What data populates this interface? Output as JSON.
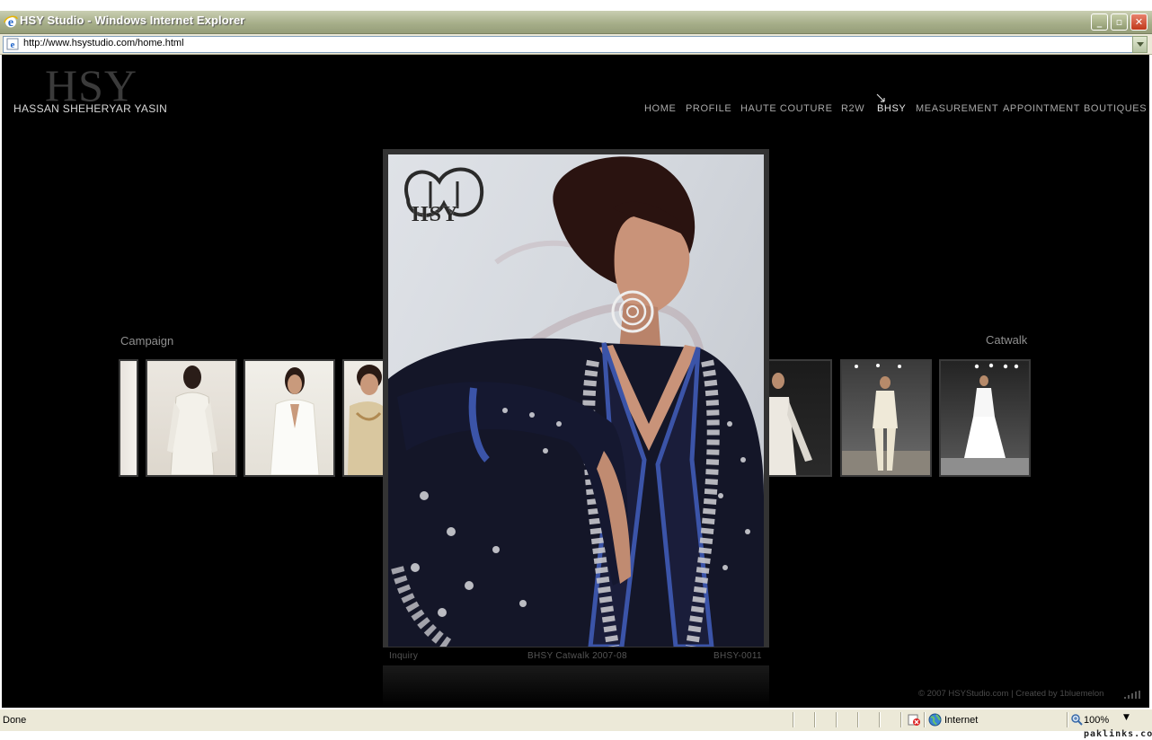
{
  "window": {
    "title": "HSY Studio - Windows Internet Explorer"
  },
  "address": {
    "url": "http://www.hsystudio.com/home.html"
  },
  "site": {
    "logo_mark": "HSY",
    "logo_name": "HASSAN SHEHERYAR YASIN",
    "nav": [
      {
        "label": "HOME",
        "active": false
      },
      {
        "label": "PROFILE",
        "active": false
      },
      {
        "label": "HAUTE COUTURE",
        "active": false
      },
      {
        "label": "R2W",
        "active": false
      },
      {
        "label": "BHSY",
        "active": true
      },
      {
        "label": "MEASUREMENT",
        "active": false
      },
      {
        "label": "APPOINTMENT",
        "active": false
      },
      {
        "label": "BOUTIQUES",
        "active": false
      }
    ],
    "campaign_label": "Campaign",
    "catwalk_label": "Catwalk",
    "feature": {
      "brand_mark": "HSY",
      "caption_left": "Inquiry",
      "caption_center": "BHSY Catwalk 2007-08",
      "caption_right": "BHSY-0011"
    },
    "copyright": "© 2007 HSYStudio.com | Created by 1bluemelon"
  },
  "status": {
    "text": "Done",
    "zone": "Internet",
    "zoom": "100%"
  },
  "watermark": "paklinks.com",
  "colors": {
    "background": "#000000",
    "nav_active": "#e8e8e8",
    "nav": "#a8a8a8",
    "title_bar": "#a7af8a"
  }
}
